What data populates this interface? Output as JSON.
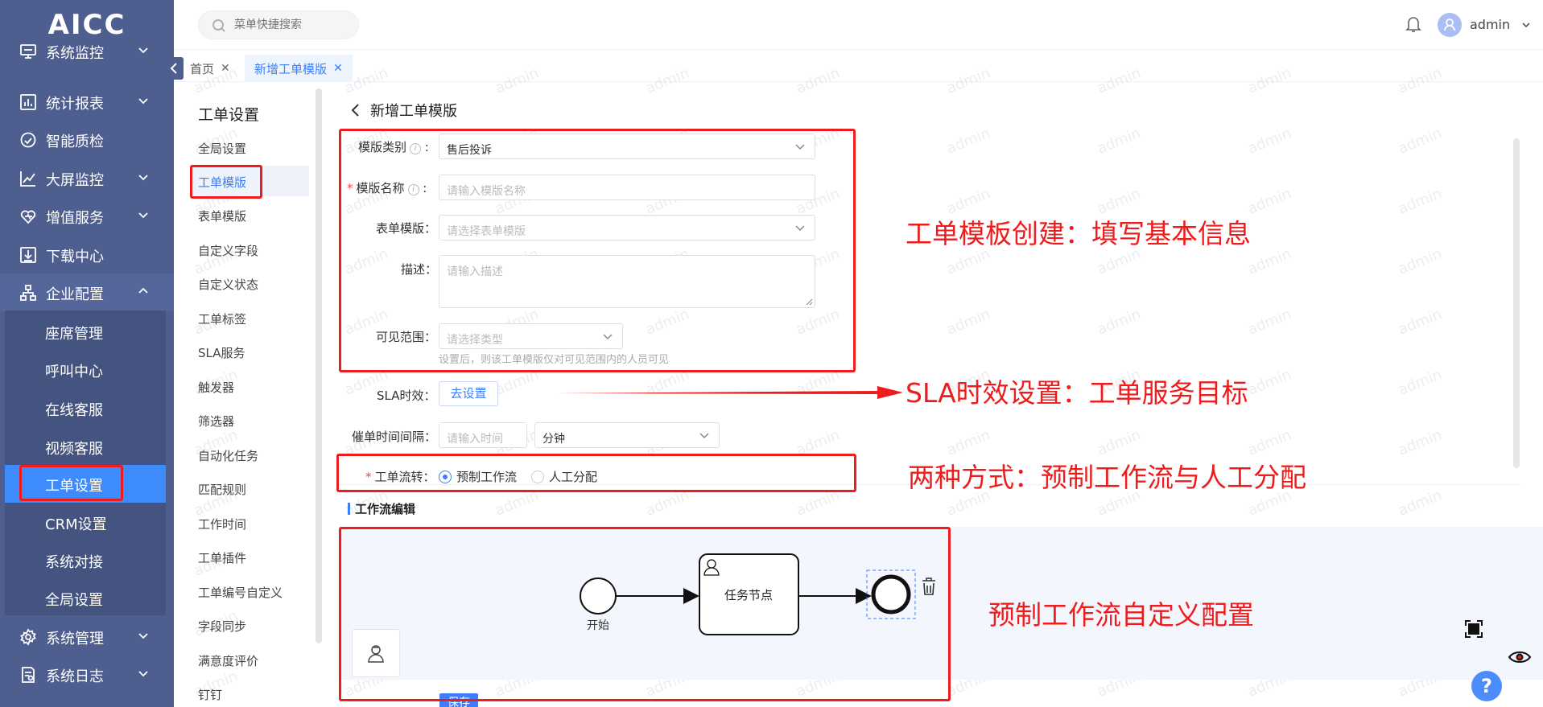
{
  "app": {
    "logo": "AICC"
  },
  "colors": {
    "sidebar": "#4d5e8f",
    "accent": "#3d7efa",
    "annotation": "#ee1c1c"
  },
  "sidebar": {
    "items": [
      {
        "label": "系统监控",
        "icon": "monitor-icon",
        "expanded": false
      },
      {
        "label": "统计报表",
        "icon": "bar-chart-icon",
        "expanded": false
      },
      {
        "label": "智能质检",
        "icon": "quality-check-icon"
      },
      {
        "label": "大屏监控",
        "icon": "trend-chart-icon",
        "expanded": false
      },
      {
        "label": "增值服务",
        "icon": "heart-icon",
        "expanded": false
      },
      {
        "label": "下载中心",
        "icon": "download-icon"
      },
      {
        "label": "企业配置",
        "icon": "org-tree-icon",
        "expanded": true
      },
      {
        "label": "系统管理",
        "icon": "gear-icon",
        "expanded": false
      },
      {
        "label": "系统日志",
        "icon": "log-icon",
        "expanded": false
      }
    ],
    "subitems": [
      "座席管理",
      "呼叫中心",
      "在线客服",
      "视频客服",
      "工单设置",
      "CRM设置",
      "系统对接",
      "全局设置"
    ],
    "active_subitem": "工单设置"
  },
  "header": {
    "search_placeholder": "菜单快捷搜索",
    "username": "admin"
  },
  "tabs": [
    {
      "label": "首页",
      "active": false
    },
    {
      "label": "新增工单模版",
      "active": true
    }
  ],
  "watermark": "admin",
  "settings_nav": {
    "title": "工单设置",
    "items": [
      "全局设置",
      "工单模版",
      "表单模版",
      "自定义字段",
      "自定义状态",
      "工单标签",
      "SLA服务",
      "触发器",
      "筛选器",
      "自动化任务",
      "匹配规则",
      "工作时间",
      "工单插件",
      "工单编号自定义",
      "字段同步",
      "满意度评价",
      "钉钉"
    ],
    "active": "工单模版"
  },
  "form": {
    "title": "新增工单模版",
    "template_type": {
      "label": "模版类别",
      "value": "售后投诉"
    },
    "template_name": {
      "label": "模版名称",
      "placeholder": "请输入模版名称",
      "required": true
    },
    "form_template": {
      "label": "表单模版",
      "placeholder": "请选择表单模版"
    },
    "description": {
      "label": "描述",
      "placeholder": "请输入描述"
    },
    "visible_scope": {
      "label": "可见范围",
      "placeholder": "请选择类型",
      "help": "设置后，则该工单模版仅对可见范围内的人员可见"
    },
    "sla": {
      "label": "SLA时效",
      "button": "去设置"
    },
    "reminder": {
      "label": "催单时间间隔",
      "placeholder": "请输入时间",
      "unit": "分钟"
    },
    "flow": {
      "label": "工单流转",
      "required": true,
      "options": [
        "预制工作流",
        "人工分配"
      ],
      "selected": "预制工作流"
    }
  },
  "workflow": {
    "title": "工作流编辑",
    "start_label": "开始",
    "task_label": "任务节点",
    "save_button": "保存"
  },
  "help_button": "?",
  "annotations": [
    "工单模板创建：填写基本信息",
    "SLA时效设置：工单服务目标",
    "两种方式：预制工作流与人工分配",
    "预制工作流自定义配置"
  ]
}
